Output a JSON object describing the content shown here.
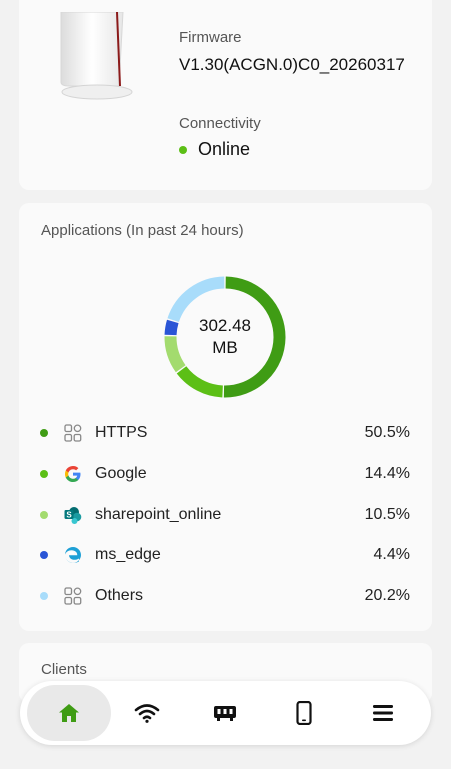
{
  "device": {
    "firmware_label": "Firmware",
    "firmware_value": "V1.30(ACGN.0)C0_20260317",
    "connectivity_label": "Connectivity",
    "connectivity_value": "Online",
    "status_color": "#5cbf16"
  },
  "applications": {
    "title": "Applications (In past 24 hours)",
    "total_value": "302.48",
    "total_unit": "MB",
    "items": [
      {
        "name": "HTTPS",
        "percent": "50.5%",
        "icon": "apps-grid-icon",
        "color": "#3f9c14"
      },
      {
        "name": "Google",
        "percent": "14.4%",
        "icon": "google-icon",
        "color": "#5cbf16"
      },
      {
        "name": "sharepoint_online",
        "percent": "10.5%",
        "icon": "sharepoint-icon",
        "color": "#a3db6e"
      },
      {
        "name": "ms_edge",
        "percent": "4.4%",
        "icon": "edge-icon",
        "color": "#2a55d6"
      },
      {
        "name": "Others",
        "percent": "20.2%",
        "icon": "apps-grid-icon",
        "color": "#a8dcfa"
      }
    ]
  },
  "clients": {
    "title": "Clients"
  },
  "tabbar": {
    "tabs": [
      {
        "name": "home",
        "icon": "home-icon",
        "active": true
      },
      {
        "name": "wifi",
        "icon": "wifi-icon",
        "active": false
      },
      {
        "name": "devices",
        "icon": "router-icon",
        "active": false
      },
      {
        "name": "mobile",
        "icon": "phone-icon",
        "active": false
      },
      {
        "name": "menu",
        "icon": "menu-icon",
        "active": false
      }
    ],
    "active_color": "#3f9c14"
  },
  "chart_data": {
    "type": "pie",
    "categories": [
      "HTTPS",
      "Google",
      "sharepoint_online",
      "ms_edge",
      "Others"
    ],
    "values": [
      50.5,
      14.4,
      10.5,
      4.4,
      20.2
    ],
    "title": "302.48 MB"
  }
}
